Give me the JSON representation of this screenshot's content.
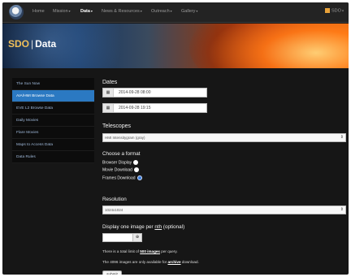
{
  "nav": {
    "items": [
      {
        "label": "Home",
        "caret": false,
        "active": false
      },
      {
        "label": "Mission",
        "caret": true,
        "active": false
      },
      {
        "label": "Data",
        "caret": true,
        "active": true
      },
      {
        "label": "News & Resources",
        "caret": true,
        "active": false
      },
      {
        "label": "Outreach",
        "caret": true,
        "active": false
      },
      {
        "label": "Gallery",
        "caret": true,
        "active": false
      }
    ],
    "right_label": "SDO"
  },
  "banner": {
    "title_sdo": "SDO",
    "title_sep": "|",
    "title_data": "Data"
  },
  "sidebar": {
    "items": [
      {
        "label": "The Sun Now",
        "active": false
      },
      {
        "label": "AIA/HMI Browse Data",
        "active": true
      },
      {
        "label": "EVE L2 Browse Data",
        "active": false
      },
      {
        "label": "Daily Movies",
        "active": false
      },
      {
        "label": "Flare Movies",
        "active": false
      },
      {
        "label": "Maps to Access Data",
        "active": false
      },
      {
        "label": "Data Rules",
        "active": false
      }
    ]
  },
  "form": {
    "dates_heading": "Dates",
    "start_date": "2014-09-28 08:00",
    "end_date": "2014-09-28 19:15",
    "telescopes_heading": "Telescopes",
    "telescope_value": "HMI Intensitygram (gray)",
    "format_heading": "Choose a format",
    "format_options": [
      {
        "label": "Browser Display",
        "selected": false
      },
      {
        "label": "Movie Download",
        "selected": false
      },
      {
        "label": "Frames Download",
        "selected": true
      }
    ],
    "resolution_heading": "Resolution",
    "resolution_value": "1024x1024",
    "cadence_prefix": "Display one image per",
    "cadence_nth": "nth",
    "cadence_suffix": "(optional)",
    "note1_prefix": "There is a total limit of",
    "note1_bold": "500 images",
    "note1_suffix": "per query.",
    "note2_prefix": "The 4096 images are only available for",
    "note2_bold": "archive",
    "note2_suffix": "download.",
    "submit_label": "submit"
  },
  "icons": {
    "calendar": "calendar-icon",
    "dropdown": "chevron-down-icon",
    "stepper": "stepper-icon"
  },
  "colors": {
    "accent": "#2b79c2",
    "logo_text": "#f0c05a",
    "nav_right_badge": "#e8a23a"
  }
}
